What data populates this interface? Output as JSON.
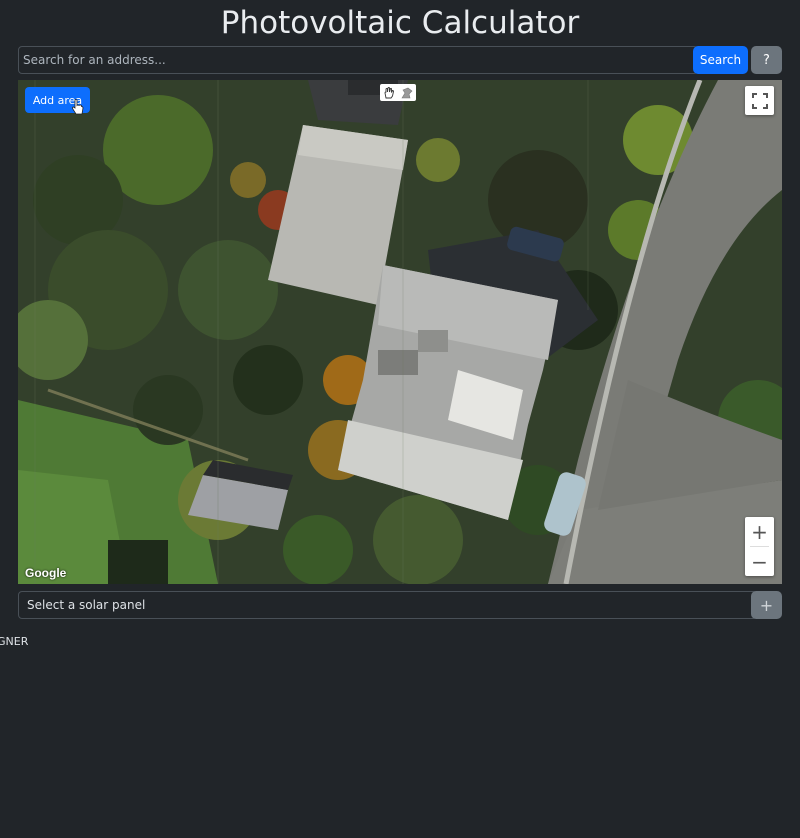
{
  "header": {
    "title": "Photovoltaic Calculator"
  },
  "search": {
    "placeholder": "Search for an address...",
    "value": "",
    "search_label": "Search",
    "help_label": "?"
  },
  "map": {
    "add_area_label": "Add area",
    "attribution": "Google",
    "zoom_in_label": "+",
    "zoom_out_label": "−",
    "icons": [
      "hand-icon",
      "polygon-draw-icon",
      "fullscreen-icon"
    ]
  },
  "solar_panel": {
    "select_label": "Select a solar panel",
    "add_label": "+"
  },
  "footer": {
    "text": "GNER"
  },
  "colors": {
    "background": "#212529",
    "primary": "#0d6efd",
    "secondary": "#6c757d",
    "border": "#495057"
  }
}
